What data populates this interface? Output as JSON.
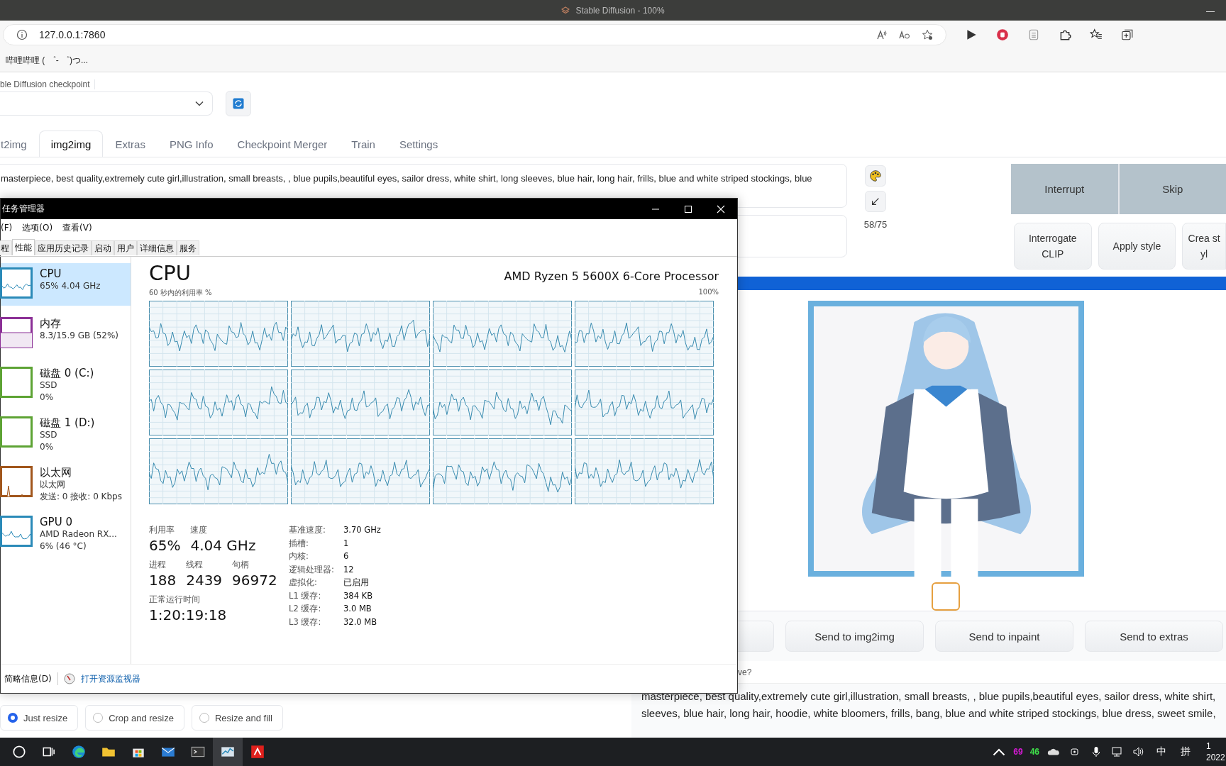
{
  "browser": {
    "title": "Stable Diffusion - 100%",
    "url": "127.0.0.1:7860",
    "bookmarks": [
      "哔哩哔哩 ( ゜- ゜)つ..."
    ]
  },
  "checkpoint": {
    "label": "ble Diffusion checkpoint"
  },
  "tabs": [
    {
      "label": "t2img",
      "selected": false
    },
    {
      "label": "img2img",
      "selected": true
    },
    {
      "label": "Extras",
      "selected": false
    },
    {
      "label": "PNG Info",
      "selected": false
    },
    {
      "label": "Checkpoint Merger",
      "selected": false
    },
    {
      "label": "Train",
      "selected": false
    },
    {
      "label": "Settings",
      "selected": false
    }
  ],
  "prompt": {
    "value": "masterpiece, best quality,extremely cute girl,illustration, small breasts, , blue pupils,beautiful eyes, sailor dress, white shirt, long sleeves, blue hair, long hair,  frills, blue and white striped stockings, blue"
  },
  "token_counter": "58/75",
  "actions": [
    "Interrupt",
    "Skip"
  ],
  "style_buttons": [
    "Interrogate CLIP",
    "Apply style",
    "Crea styl"
  ],
  "send_buttons": [
    "Send to img2img",
    "Send to inpaint",
    "Send to extras"
  ],
  "info_text": "ve?",
  "output_prompt": [
    "masterpiece, best quality,extremely cute girl,illustration, small breasts, , blue pupils,beautiful eyes, sailor dress, white shirt,",
    "sleeves, blue hair, long hair, hoodie, white bloomers, frills, bang, blue and white striped stockings, blue dress, sweet smile,"
  ],
  "resize_modes": [
    {
      "label": "Just resize",
      "selected": true
    },
    {
      "label": "Crop and resize",
      "selected": false
    },
    {
      "label": "Resize and fill",
      "selected": false
    }
  ],
  "task_manager": {
    "title": "任务管理器",
    "menu": [
      "(F)",
      "选项(O)",
      "查看(V)"
    ],
    "tabs": [
      {
        "label": "程",
        "selected": false
      },
      {
        "label": "性能",
        "selected": true
      },
      {
        "label": "应用历史记录",
        "selected": false
      },
      {
        "label": "启动",
        "selected": false
      },
      {
        "label": "用户",
        "selected": false
      },
      {
        "label": "详细信息",
        "selected": false
      },
      {
        "label": "服务",
        "selected": false
      }
    ],
    "resources": [
      {
        "name": "CPU",
        "lines": [
          "65% 4.04 GHz"
        ],
        "kind": "line",
        "color": "#2a8ab8",
        "selected": true
      },
      {
        "name": "内存",
        "lines": [
          "8.3/15.9 GB (52%)"
        ],
        "kind": "fill",
        "color": "#8b2f96",
        "selected": false
      },
      {
        "name": "磁盘 0 (C:)",
        "lines": [
          "SSD",
          "0%"
        ],
        "kind": "empty",
        "color": "#5da334",
        "selected": false
      },
      {
        "name": "磁盘 1 (D:)",
        "lines": [
          "SSD",
          "0%"
        ],
        "kind": "empty",
        "color": "#5da334",
        "selected": false
      },
      {
        "name": "以太网",
        "lines": [
          "以太网",
          "发送: 0 接收: 0 Kbps"
        ],
        "kind": "spike",
        "color": "#a1561c",
        "selected": false
      },
      {
        "name": "GPU 0",
        "lines": [
          "AMD Radeon RX...",
          "6% (46 °C)"
        ],
        "kind": "line",
        "color": "#2a8ab8",
        "selected": false
      }
    ],
    "heading": "CPU",
    "processor": "AMD Ryzen 5 5600X 6-Core Processor",
    "graph_label": "60 秒内的利用率 %",
    "graph_max": "100%",
    "stat_rows": [
      [
        {
          "label": "利用率",
          "value": "65%"
        },
        {
          "label": "速度",
          "value": "4.04 GHz"
        }
      ],
      [
        {
          "label": "进程",
          "value": "188"
        },
        {
          "label": "线程",
          "value": "2439"
        },
        {
          "label": "句柄",
          "value": "96972"
        }
      ],
      [
        {
          "label": "正常运行时间",
          "value": "1:20:19:18"
        }
      ]
    ],
    "details": [
      {
        "label": "基准速度:",
        "value": "3.70 GHz"
      },
      {
        "label": "插槽:",
        "value": "1"
      },
      {
        "label": "内核:",
        "value": "6"
      },
      {
        "label": "逻辑处理器:",
        "value": "12"
      },
      {
        "label": "虚拟化:",
        "value": "已启用"
      },
      {
        "label": "L1 缓存:",
        "value": "384 KB"
      },
      {
        "label": "L2 缓存:",
        "value": "3.0 MB"
      },
      {
        "label": "L3 缓存:",
        "value": "32.0 MB"
      }
    ],
    "fewer_details": "简略信息(D)",
    "open_monitor": "打开资源监视器"
  },
  "taskbar": {
    "tray": [
      {
        "text": "69",
        "color": "#d61ad6"
      },
      {
        "text": "46",
        "color": "#3fe04a"
      }
    ],
    "ime": [
      "中",
      "拼"
    ],
    "clock": [
      "1",
      "2022"
    ]
  }
}
